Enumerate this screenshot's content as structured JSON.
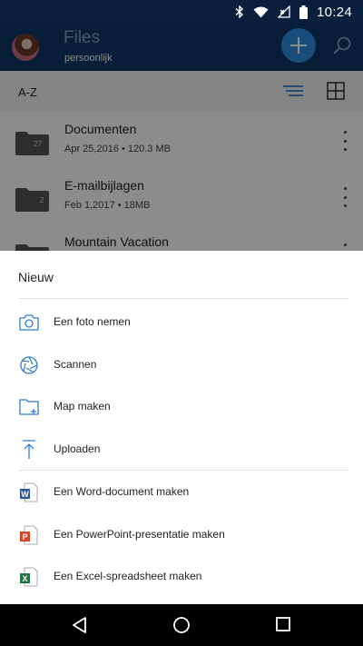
{
  "status_bar": {
    "time": "10:24"
  },
  "app_bar": {
    "title": "Files",
    "subtitle": "persoonlijk"
  },
  "toolbar": {
    "sort_label": "A-Z"
  },
  "files": [
    {
      "name": "Documenten",
      "meta": "Apr 25,2016 • 120.3 MB",
      "badge": "27"
    },
    {
      "name": "E-mailbijlagen",
      "meta": "Feb 1,2017 • 18MB",
      "badge": "2"
    },
    {
      "name": "Mountain Vacation",
      "meta": "",
      "badge": ""
    }
  ],
  "sheet": {
    "title": "Nieuw",
    "items": [
      {
        "label": "Een foto nemen",
        "icon": "camera-icon"
      },
      {
        "label": "Scannen",
        "icon": "scan-lens-icon"
      },
      {
        "label": "Map maken",
        "icon": "new-folder-icon"
      },
      {
        "label": "Uploaden",
        "icon": "upload-icon"
      },
      {
        "label": "Een Word-document maken",
        "icon": "word-doc-icon"
      },
      {
        "label": "Een PowerPoint-presentatie maken",
        "icon": "powerpoint-doc-icon"
      },
      {
        "label": "Een Excel-spreadsheet maken",
        "icon": "excel-doc-icon"
      }
    ]
  },
  "colors": {
    "app_bar": "#0d3667",
    "accent": "#2e8de0",
    "icon_blue": "#2e7bd1",
    "word": "#2b579a",
    "powerpoint": "#d24726",
    "excel": "#217346"
  }
}
